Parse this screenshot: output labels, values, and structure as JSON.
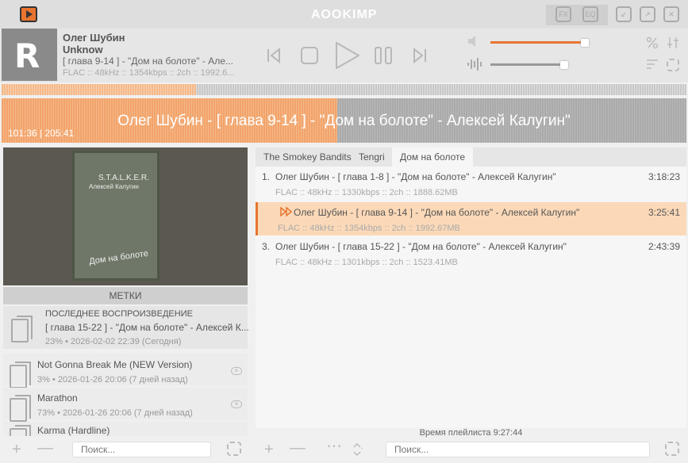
{
  "app": {
    "name": "AOOKIMP"
  },
  "titlebar": {
    "fx_label": "FX",
    "eq_label": "EQ"
  },
  "now_playing": {
    "artist": "Олег Шубин",
    "album": "Unknow",
    "title": "[ глава 9-14 ] - \"Дом на болоте\" - Але...",
    "info": "FLAC :: 48kHz :: 1354kbps :: 2ch :: 1992.6...",
    "cover_letters": "R",
    "full_title": "Олег Шубин - [ глава 9-14 ] - \"Дом на болоте\" - Алексей Калугин\"",
    "time": "101:36 | 205:41",
    "progress": 0.49,
    "volume": 0.8,
    "balance": 0.75
  },
  "art": {
    "title1": "S.T.A.L.K.E.R.",
    "title2": "Алексей Калугин",
    "title3": "Дом на болоте"
  },
  "marks": {
    "header": "МЕТКИ",
    "last": {
      "label": "ПОСЛЕДНЕЕ ВОСПРОИЗВЕДЕНИЕ",
      "title": "[ глава 15-22 ] - \"Дом на болоте\" - Алексей К...",
      "sub": "23% • 2026-02-02 22:39 (Сегодня)"
    },
    "items": [
      {
        "title": "Not Gonna Break Me (NEW Version)",
        "sub": "3% • 2026-01-26 20:06 (7 дней назад)"
      },
      {
        "title": "Marathon",
        "sub": "73% • 2026-01-26 20:06 (7 дней назад)"
      },
      {
        "title": "Karma (Hardline)",
        "sub": ""
      }
    ]
  },
  "tabs": [
    "The Smokey Bandits",
    "Tengri",
    "Дом на болоте"
  ],
  "playlist": {
    "rows": [
      {
        "num": "1.",
        "title": "Олег Шубин - [ глава 1-8 ] - \"Дом на болоте\" - Алексей Калугин\"",
        "dur": "3:18:23",
        "info": "FLAC :: 48kHz :: 1330kbps :: 2ch :: 1888.62MB"
      },
      {
        "num": "",
        "title": "Олег Шубин - [ глава 9-14 ] - \"Дом на болоте\" - Алексей Калугин\"",
        "dur": "3:25:41",
        "info": "FLAC :: 48kHz :: 1354kbps :: 2ch :: 1992.67MB"
      },
      {
        "num": "3.",
        "title": "Олег Шубин - [ глава 15-22 ] - \"Дом на болоте\" - Алексей Калугин\"",
        "dur": "2:43:39",
        "info": "FLAC :: 48kHz :: 1301kbps :: 2ch :: 1523.41MB"
      }
    ],
    "total_time": "Время плейлиста 9:27:44"
  },
  "search": {
    "placeholder": "Поиск..."
  },
  "colors": {
    "accent": "#e8752f",
    "active_row": "#fbd9b8"
  }
}
